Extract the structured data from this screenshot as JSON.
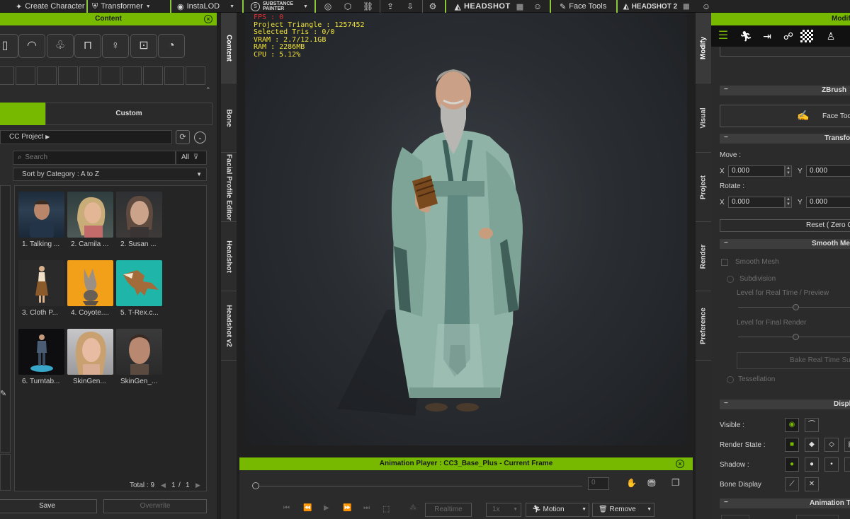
{
  "toolbar": {
    "create_character": "Create Character",
    "transformer": "Transformer",
    "insta_lod": "InstaLOD",
    "substance_top": "SUBSTANCE",
    "substance_bottom": "PAINTER",
    "headshot": "HEADSHOT",
    "face_tools": "Face Tools",
    "headshot2": "HEADSHOT 2"
  },
  "content_panel": {
    "title": "Content",
    "custom_tab": "Custom",
    "folder": "CC Project",
    "search_placeholder": "Search",
    "filter_all": "All",
    "sort": "Sort by Category : A to Z",
    "items": [
      {
        "label": "1. Talking ..."
      },
      {
        "label": "2. Camila ..."
      },
      {
        "label": "2. Susan ..."
      },
      {
        "label": "3. Cloth P..."
      },
      {
        "label": "4. Coyote...."
      },
      {
        "label": "5. T-Rex.c..."
      },
      {
        "label": "6. Turntab..."
      },
      {
        "label": "SkinGen..."
      },
      {
        "label": "SkinGen_..."
      }
    ],
    "total_label": "Total : 9",
    "page_current": "1",
    "page_sep": "/",
    "page_total": "1",
    "save_label": "Save",
    "overwrite_label": "Overwrite"
  },
  "left_tabs": [
    "Content",
    "Bone",
    "Facial Profile Editor",
    "Headshot",
    "Headshot v2"
  ],
  "right_tabs": [
    "Modify",
    "Visual",
    "Project",
    "Render",
    "Preference"
  ],
  "viewport": {
    "fps": "FPS : 0",
    "project_triangle": "Project Triangle : 1257452",
    "selected_tris": "Selected Tris : 0/0",
    "vram": "VRAM : 2.7/12.1GB",
    "ram": "RAM : 2286MB",
    "cpu": "CPU : 5.12%"
  },
  "animation_player": {
    "title": "Animation Player : CC3_Base_Plus - Current Frame",
    "frame_value": "0",
    "realtime": "Realtime",
    "speed": "1x",
    "motion": "Motion",
    "remove": "Remove"
  },
  "modify_panel": {
    "title": "Modify",
    "zbrush_title": "ZBrush",
    "face_tools_btn": "Face Too",
    "transform_title": "Transform",
    "move_label": "Move :",
    "rotate_label": "Rotate :",
    "x_label": "X",
    "y_label": "Y",
    "move_x": "0.000",
    "move_y": "0.000",
    "rotate_x": "0.000",
    "rotate_y": "0.000",
    "reset_btn": "Reset ( Zero C",
    "smooth_title": "Smooth Mes",
    "smooth_mesh": "Smooth Mesh",
    "subdivision": "Subdivision",
    "level_realtime": "Level for Real Time / Preview",
    "level_final": "Level for Final Render",
    "bake_btn": "Bake Real Time Su",
    "tessellation": "Tessellation",
    "display_title": "Display",
    "visible": "Visible :",
    "render_state": "Render State :",
    "shadow": "Shadow :",
    "bone_display": "Bone Display",
    "anim_title": "Animation Ta"
  }
}
